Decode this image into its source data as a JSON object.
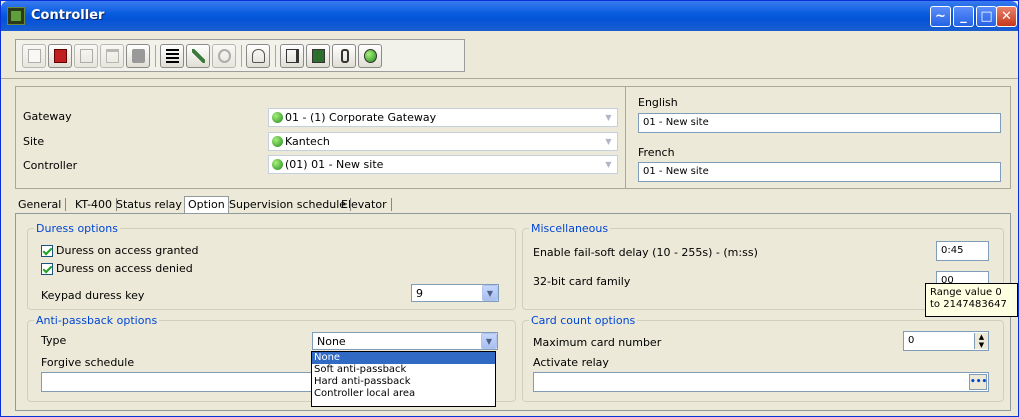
{
  "window": {
    "title": "Controller"
  },
  "header": {
    "rows": [
      {
        "label": "Gateway",
        "value": "01 - (1)  Corporate Gateway"
      },
      {
        "label": "Site",
        "value": "Kantech"
      },
      {
        "label": "Controller",
        "value": "(01) 01 - New site"
      }
    ],
    "languages": [
      {
        "label": "English",
        "value": "01 - New site"
      },
      {
        "label": "French",
        "value": "01 - New site"
      }
    ]
  },
  "tabs": [
    "General",
    "KT-400",
    "Status relay",
    "Option",
    "Supervision schedule",
    "Elevator"
  ],
  "active_tab": "Option",
  "duress": {
    "title": "Duress options",
    "granted_label": "Duress on access granted",
    "denied_label": "Duress on access denied",
    "key_label": "Keypad duress key",
    "key_value": "9"
  },
  "antipassback": {
    "title": "Anti-passback options",
    "type_label": "Type",
    "type_value": "None",
    "forgive_label": "Forgive schedule",
    "options": [
      "None",
      "Soft anti-passback",
      "Hard anti-passback",
      "Controller local area"
    ]
  },
  "misc": {
    "title": "Miscellaneous",
    "failsoft_label": "Enable fail-soft delay (10 - 255s) - (m:ss)",
    "failsoft_value": "0:45",
    "card_family_label": "32-bit card family",
    "card_family_value": "00"
  },
  "cardcount": {
    "title": "Card count options",
    "max_label": "Maximum card number",
    "max_value": "0",
    "relay_label": "Activate relay",
    "relay_button": "•••"
  },
  "tooltip": {
    "text": "Range value 0 to 2147483647"
  },
  "icons": {
    "app": "controller-app-icon",
    "toolbar": [
      "new-icon",
      "save-icon",
      "copy-icon",
      "delete-icon",
      "print-icon",
      "list-icon",
      "link-icon",
      "find-icon",
      "user-icon",
      "door-icon",
      "relay-icon",
      "input-icon",
      "status-led-icon"
    ]
  },
  "colors": {
    "title_bar": "#0453d8",
    "group_title": "#0046d5",
    "selection": "#316ac5",
    "status_green": "#1e8a1e"
  }
}
